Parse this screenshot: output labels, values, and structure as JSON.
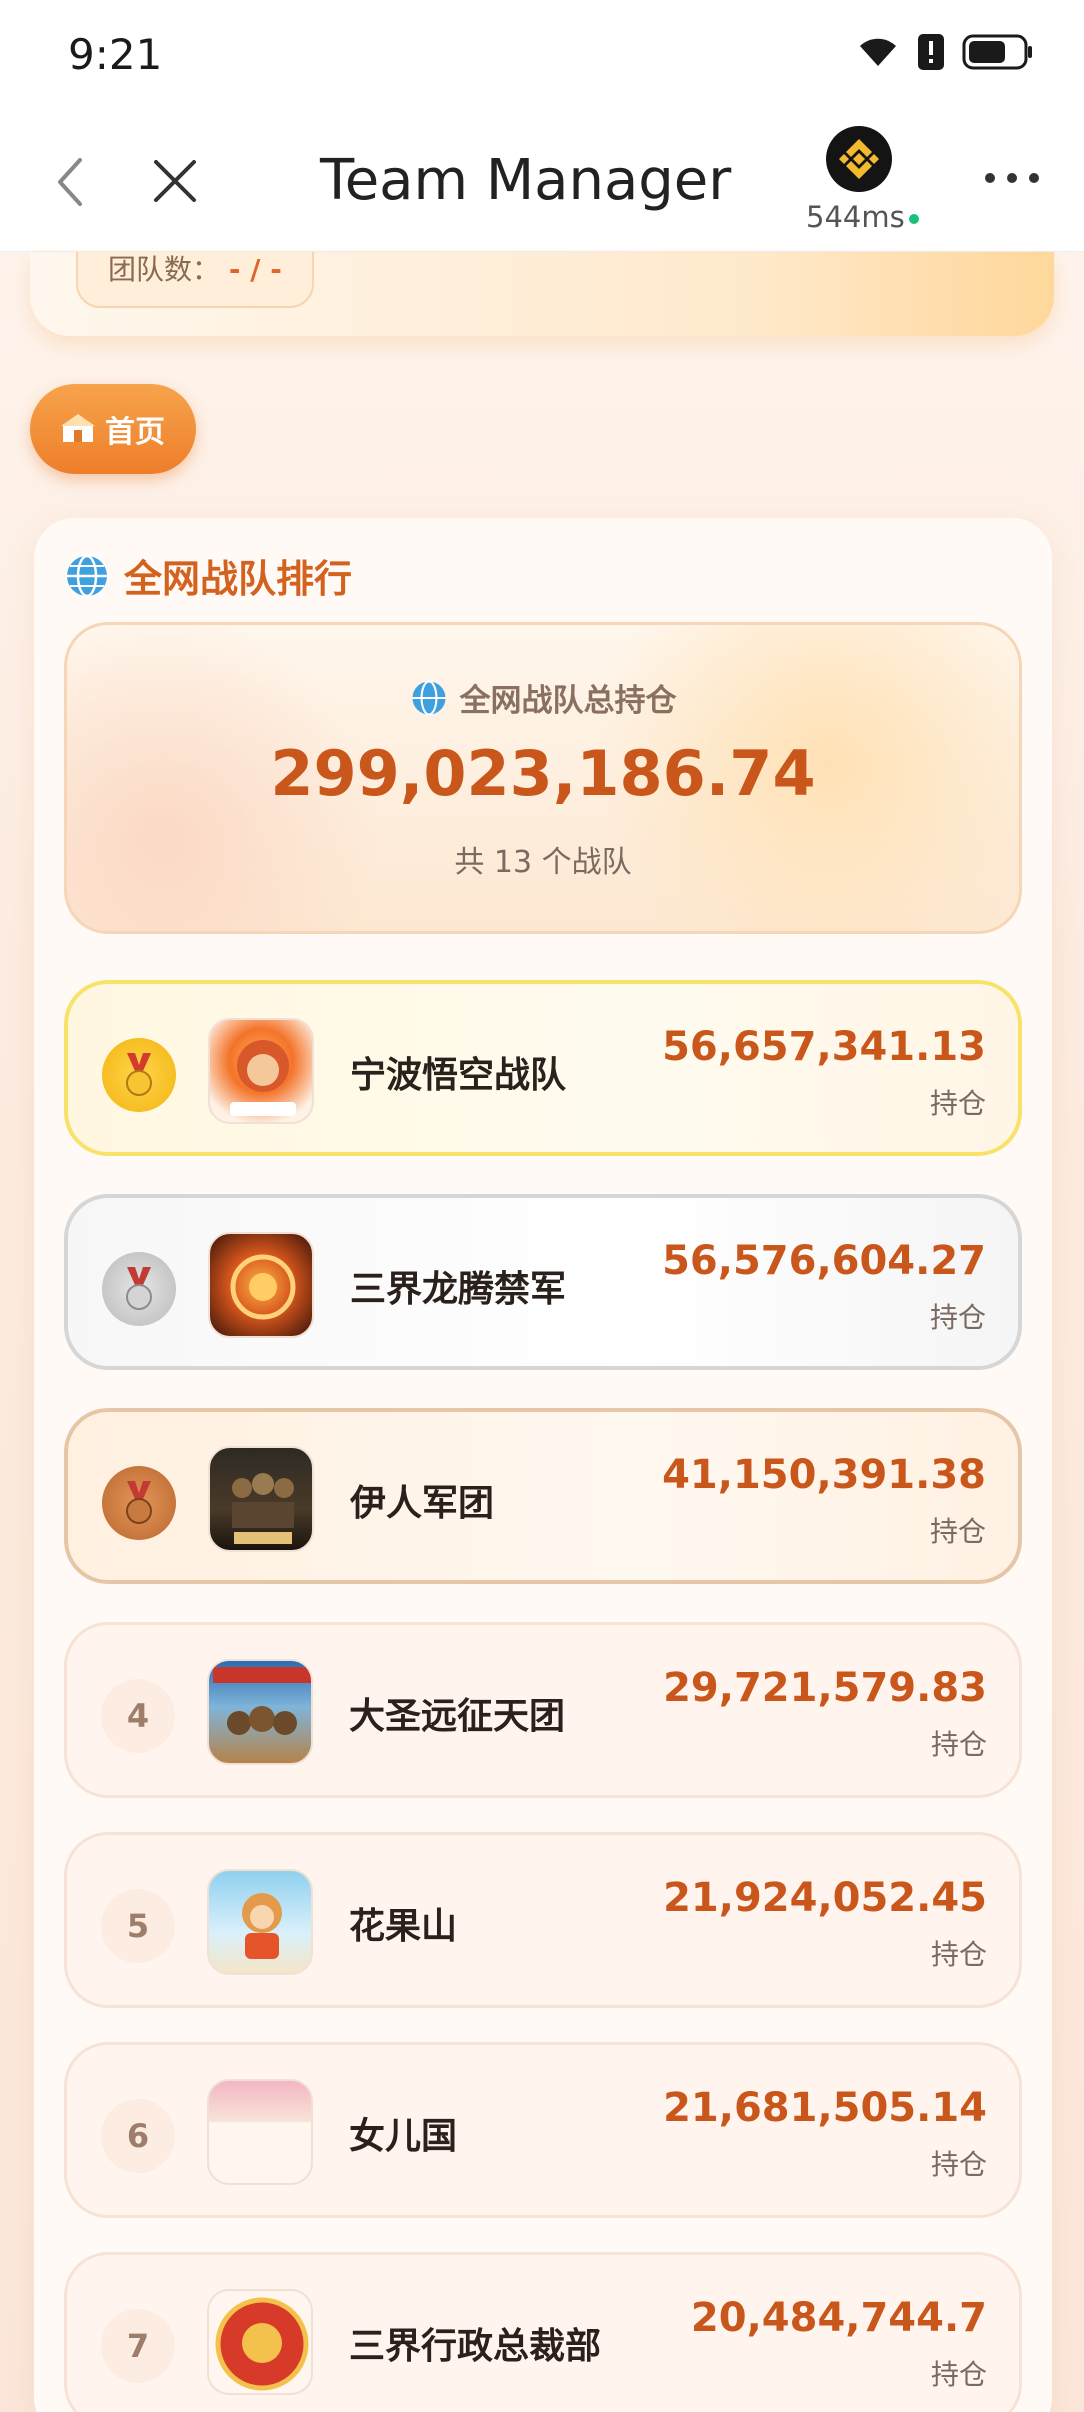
{
  "status_bar": {
    "time": "9:21"
  },
  "header": {
    "title": "Team Manager",
    "latency": "544ms"
  },
  "prev_card": {
    "label": "团队数：",
    "value": "- / -"
  },
  "home_button": {
    "label": "首页"
  },
  "ranking": {
    "title": "全网战队排行",
    "total_label": "全网战队总持仓",
    "total_value": "299,023,186.74",
    "total_count": "共 13 个战队",
    "unit": "持仓",
    "rows": [
      {
        "rank": "1",
        "name": "宁波悟空战队",
        "value": "56,657,341.13"
      },
      {
        "rank": "2",
        "name": "三界龙腾禁军",
        "value": "56,576,604.27"
      },
      {
        "rank": "3",
        "name": "伊人军团",
        "value": "41,150,391.38"
      },
      {
        "rank": "4",
        "name": "大圣远征天团",
        "value": "29,721,579.83"
      },
      {
        "rank": "5",
        "name": "花果山",
        "value": "21,924,052.45"
      },
      {
        "rank": "6",
        "name": "女儿国",
        "value": "21,681,505.14"
      },
      {
        "rank": "7",
        "name": "三界行政总裁部",
        "value": "20,484,744.7"
      }
    ]
  },
  "colors": {
    "accent": "#c9561b",
    "gold": "#f8e26a",
    "silver": "#d6d6d6",
    "bronze": "#e5c6a6"
  }
}
